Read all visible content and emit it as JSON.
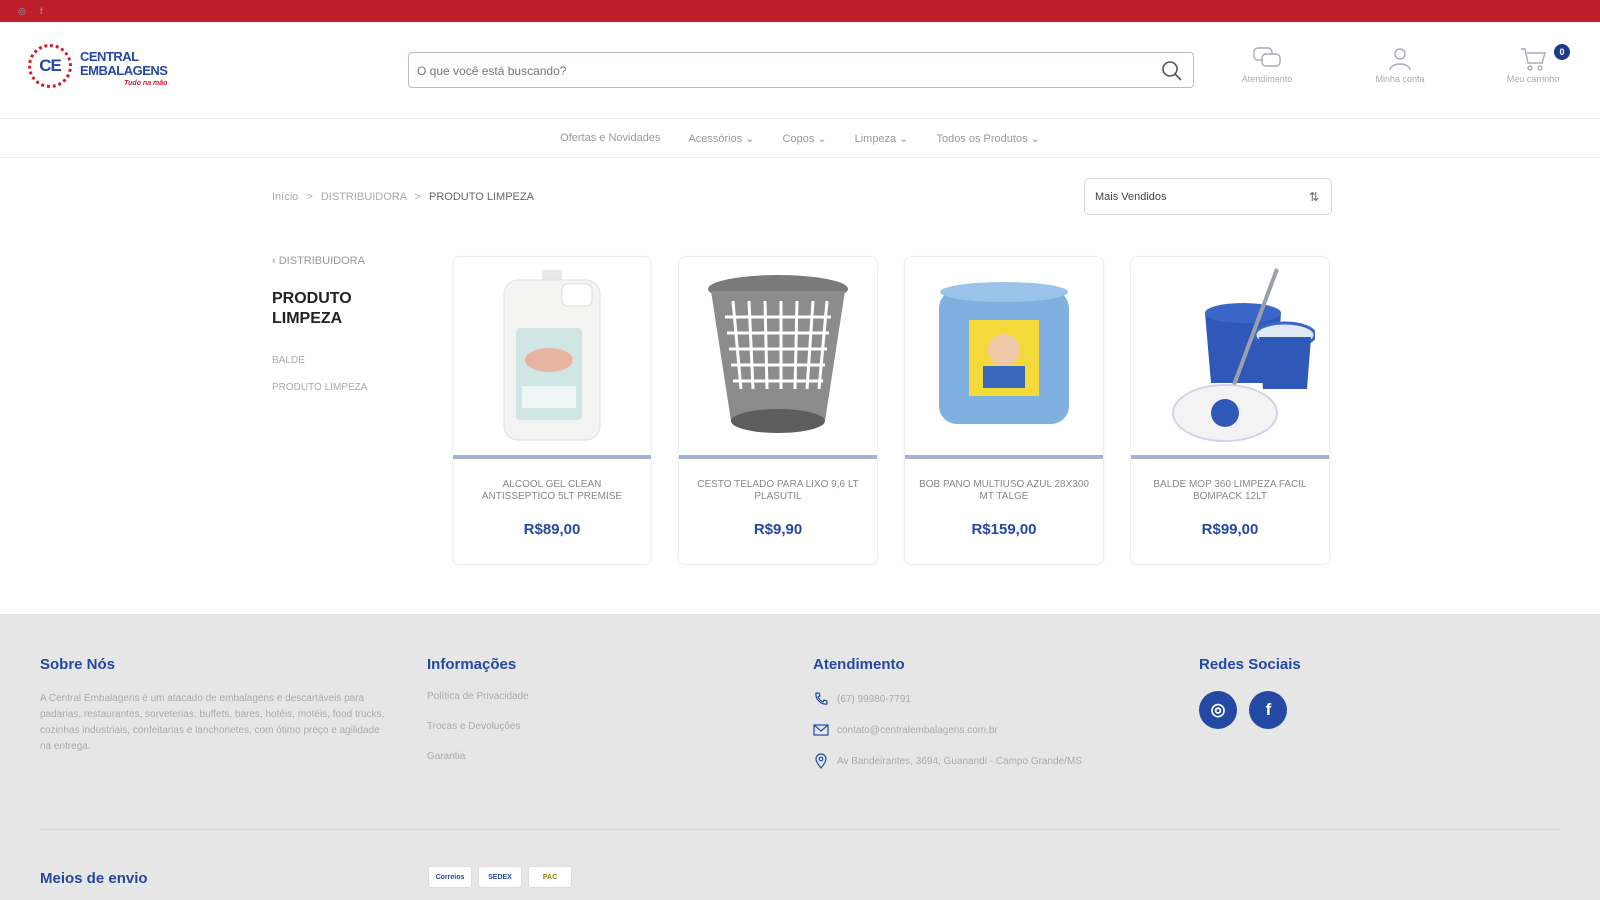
{
  "header": {
    "logo_text_line1": "CENTRAL",
    "logo_text_line2": "EMBALAGENS",
    "logo_mark": "CE",
    "logo_tagline": "Tudo na mão",
    "search_placeholder": "O que você está buscando?",
    "links": [
      {
        "label": "Atendimento",
        "icon": "chat-icon"
      },
      {
        "label": "Minha conta",
        "icon": "user-icon"
      },
      {
        "label": "Meu carrinho",
        "icon": "cart-icon"
      }
    ],
    "cart_count": "0"
  },
  "nav": {
    "items": [
      "Ofertas e Novidades",
      "Acessórios ⌄",
      "Copos ⌄",
      "Limpeza ⌄",
      "Todos os Produtos ⌄"
    ]
  },
  "breadcrumb": {
    "home": "Início",
    "sep": ">",
    "parent": "DISTRIBUIDORA",
    "current": "PRODUTO LIMPEZA"
  },
  "sort": {
    "value": "Mais Vendidos",
    "icon": "sort-icon"
  },
  "sidebar": {
    "back_label": "DISTRIBUIDORA",
    "title": "PRODUTO LIMPEZA",
    "subcategories": [
      "BALDE",
      "PRODUTO LIMPEZA"
    ]
  },
  "products": [
    {
      "name": "ALCOOL GEL CLEAN ANTISSEPTICO 5LT PREMISE",
      "price": "R$89,00"
    },
    {
      "name": "CESTO TELADO PARA LIXO 9,6 LT PLASUTIL",
      "price": "R$9,90"
    },
    {
      "name": "BOB PANO MULTIUSO AZUL 28X300 MT TALGE",
      "price": "R$159,00"
    },
    {
      "name": "BALDE MOP 360 LIMPEZA FACIL BOMPACK 12LT",
      "price": "R$99,00"
    }
  ],
  "footer": {
    "about": {
      "title": "Sobre Nós",
      "text": "A Central Embalagens é um atacado de embalagens e descartáveis para padarias, restaurantes, sorveterias, buffets, bares, hotéis, motéis, food trucks, cozinhas industriais, confeitarias e lanchonetes, com ótimo preço e agilidade na entrega."
    },
    "info": {
      "title": "Informações",
      "links": [
        "Política de Privacidade",
        "Trocas e Devoluções",
        "Garantia"
      ]
    },
    "support": {
      "title": "Atendimento",
      "phone": "(67) 99980-7791",
      "email": "contato@centralembalagens.com.br",
      "address": "Av Bandeirantes, 3694, Guanandi - Campo Grande/MS"
    },
    "social": {
      "title": "Redes Sociais",
      "instagram": "◎",
      "facebook": "f"
    },
    "shipping_title": "Meios de envio",
    "shipping_logos": [
      "Correios",
      "SEDEX",
      "PAC"
    ]
  },
  "colors": {
    "topbar": "#bd1f2a",
    "brand_blue": "#2449a2",
    "footer_bg": "#e6e6e6"
  }
}
